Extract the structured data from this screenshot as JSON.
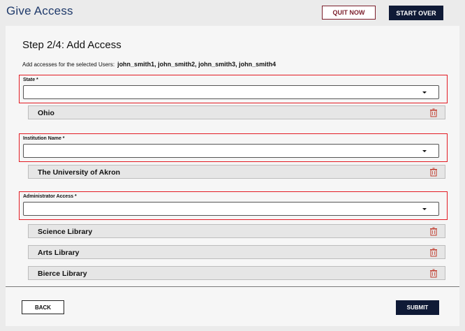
{
  "header": {
    "title": "Give Access",
    "quit_label": "QUIT NOW",
    "start_over_label": "START OVER"
  },
  "form": {
    "step_title": "Step 2/4: Add Access",
    "subtitle_prefix": "Add accesses for the selected Users:",
    "selected_users": "john_smith1, john_smith2, john_smith3, john_smith4",
    "fields": [
      {
        "label": "State *",
        "value": "",
        "items": [
          "Ohio"
        ]
      },
      {
        "label": "Institution Name *",
        "value": "",
        "items": [
          "The University of Akron"
        ]
      },
      {
        "label": "Administrator Access *",
        "value": "",
        "items": [
          "Science Library",
          "Arts Library",
          "Bierce Library"
        ]
      }
    ]
  },
  "footer": {
    "back_label": "BACK",
    "submit_label": "SUBMIT"
  },
  "colors": {
    "title": "#1f3a6b",
    "quit_border": "#7b1e2b",
    "primary_dark": "#0f1a36",
    "highlight_red": "#e31b23",
    "trash_icon": "#c0392b"
  },
  "icons": {
    "dropdown": "chevron-down-icon",
    "delete": "trash-icon"
  }
}
